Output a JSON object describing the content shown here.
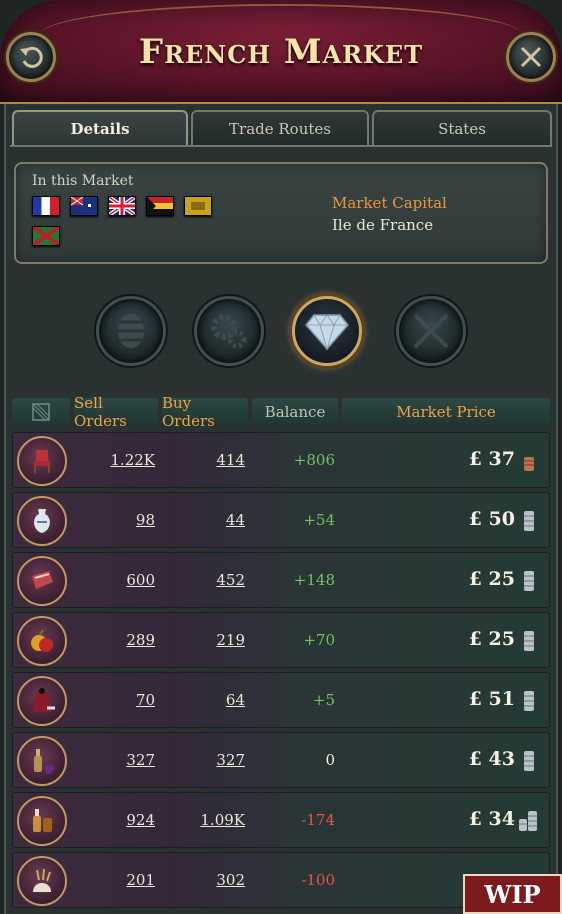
{
  "header": {
    "title": "French Market"
  },
  "tabs": [
    {
      "label": "Details"
    },
    {
      "label": "Trade Routes"
    },
    {
      "label": "States"
    }
  ],
  "info": {
    "in_market_label": "In this Market",
    "capital_label": "Market Capital",
    "capital_value": "Ile de France"
  },
  "columns": {
    "sell": "Sell Orders",
    "buy": "Buy Orders",
    "balance": "Balance",
    "price": "Market Price"
  },
  "goods": [
    {
      "icon": "furniture-icon",
      "sell": "1.22K",
      "buy": "414",
      "balance": "+806",
      "price": "£ 37",
      "price_trend": "low"
    },
    {
      "icon": "porcelain-icon",
      "sell": "98",
      "buy": "44",
      "balance": "+54",
      "price": "£ 50",
      "price_trend": "normal"
    },
    {
      "icon": "meat-icon",
      "sell": "600",
      "buy": "452",
      "balance": "+148",
      "price": "£ 25",
      "price_trend": "normal"
    },
    {
      "icon": "fruit-icon",
      "sell": "289",
      "buy": "219",
      "balance": "+70",
      "price": "£ 25",
      "price_trend": "normal"
    },
    {
      "icon": "luxury-clothes-icon",
      "sell": "70",
      "buy": "64",
      "balance": "+5",
      "price": "£ 51",
      "price_trend": "normal"
    },
    {
      "icon": "wine-icon",
      "sell": "327",
      "buy": "327",
      "balance": "0",
      "price": "£ 43",
      "price_trend": "normal"
    },
    {
      "icon": "liquor-icon",
      "sell": "924",
      "buy": "1.09K",
      "balance": "-174",
      "price": "£ 34",
      "price_trend": "high"
    },
    {
      "icon": "grain-icon",
      "sell": "201",
      "buy": "302",
      "balance": "-100",
      "price": "",
      "price_trend": ""
    }
  ],
  "wip_label": "WIP",
  "colors": {
    "positive": "#6fc25a",
    "negative": "#e45446",
    "accent": "#f0a240",
    "gold": "#c9a865"
  }
}
